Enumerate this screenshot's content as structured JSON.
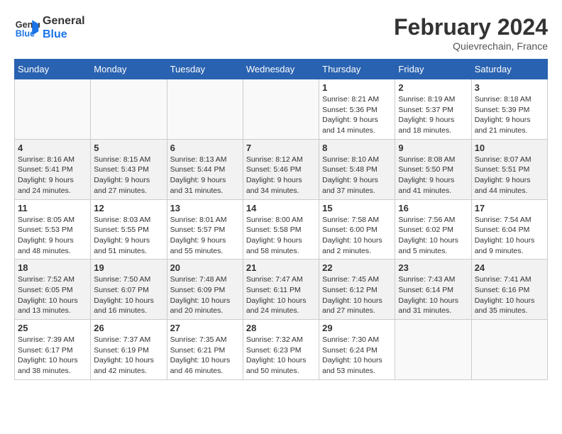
{
  "header": {
    "logo_line1": "General",
    "logo_line2": "Blue",
    "month_title": "February 2024",
    "location": "Quievrechain, France"
  },
  "days_of_week": [
    "Sunday",
    "Monday",
    "Tuesday",
    "Wednesday",
    "Thursday",
    "Friday",
    "Saturday"
  ],
  "weeks": [
    [
      {
        "day": "",
        "info": ""
      },
      {
        "day": "",
        "info": ""
      },
      {
        "day": "",
        "info": ""
      },
      {
        "day": "",
        "info": ""
      },
      {
        "day": "1",
        "info": "Sunrise: 8:21 AM\nSunset: 5:36 PM\nDaylight: 9 hours\nand 14 minutes."
      },
      {
        "day": "2",
        "info": "Sunrise: 8:19 AM\nSunset: 5:37 PM\nDaylight: 9 hours\nand 18 minutes."
      },
      {
        "day": "3",
        "info": "Sunrise: 8:18 AM\nSunset: 5:39 PM\nDaylight: 9 hours\nand 21 minutes."
      }
    ],
    [
      {
        "day": "4",
        "info": "Sunrise: 8:16 AM\nSunset: 5:41 PM\nDaylight: 9 hours\nand 24 minutes."
      },
      {
        "day": "5",
        "info": "Sunrise: 8:15 AM\nSunset: 5:43 PM\nDaylight: 9 hours\nand 27 minutes."
      },
      {
        "day": "6",
        "info": "Sunrise: 8:13 AM\nSunset: 5:44 PM\nDaylight: 9 hours\nand 31 minutes."
      },
      {
        "day": "7",
        "info": "Sunrise: 8:12 AM\nSunset: 5:46 PM\nDaylight: 9 hours\nand 34 minutes."
      },
      {
        "day": "8",
        "info": "Sunrise: 8:10 AM\nSunset: 5:48 PM\nDaylight: 9 hours\nand 37 minutes."
      },
      {
        "day": "9",
        "info": "Sunrise: 8:08 AM\nSunset: 5:50 PM\nDaylight: 9 hours\nand 41 minutes."
      },
      {
        "day": "10",
        "info": "Sunrise: 8:07 AM\nSunset: 5:51 PM\nDaylight: 9 hours\nand 44 minutes."
      }
    ],
    [
      {
        "day": "11",
        "info": "Sunrise: 8:05 AM\nSunset: 5:53 PM\nDaylight: 9 hours\nand 48 minutes."
      },
      {
        "day": "12",
        "info": "Sunrise: 8:03 AM\nSunset: 5:55 PM\nDaylight: 9 hours\nand 51 minutes."
      },
      {
        "day": "13",
        "info": "Sunrise: 8:01 AM\nSunset: 5:57 PM\nDaylight: 9 hours\nand 55 minutes."
      },
      {
        "day": "14",
        "info": "Sunrise: 8:00 AM\nSunset: 5:58 PM\nDaylight: 9 hours\nand 58 minutes."
      },
      {
        "day": "15",
        "info": "Sunrise: 7:58 AM\nSunset: 6:00 PM\nDaylight: 10 hours\nand 2 minutes."
      },
      {
        "day": "16",
        "info": "Sunrise: 7:56 AM\nSunset: 6:02 PM\nDaylight: 10 hours\nand 5 minutes."
      },
      {
        "day": "17",
        "info": "Sunrise: 7:54 AM\nSunset: 6:04 PM\nDaylight: 10 hours\nand 9 minutes."
      }
    ],
    [
      {
        "day": "18",
        "info": "Sunrise: 7:52 AM\nSunset: 6:05 PM\nDaylight: 10 hours\nand 13 minutes."
      },
      {
        "day": "19",
        "info": "Sunrise: 7:50 AM\nSunset: 6:07 PM\nDaylight: 10 hours\nand 16 minutes."
      },
      {
        "day": "20",
        "info": "Sunrise: 7:48 AM\nSunset: 6:09 PM\nDaylight: 10 hours\nand 20 minutes."
      },
      {
        "day": "21",
        "info": "Sunrise: 7:47 AM\nSunset: 6:11 PM\nDaylight: 10 hours\nand 24 minutes."
      },
      {
        "day": "22",
        "info": "Sunrise: 7:45 AM\nSunset: 6:12 PM\nDaylight: 10 hours\nand 27 minutes."
      },
      {
        "day": "23",
        "info": "Sunrise: 7:43 AM\nSunset: 6:14 PM\nDaylight: 10 hours\nand 31 minutes."
      },
      {
        "day": "24",
        "info": "Sunrise: 7:41 AM\nSunset: 6:16 PM\nDaylight: 10 hours\nand 35 minutes."
      }
    ],
    [
      {
        "day": "25",
        "info": "Sunrise: 7:39 AM\nSunset: 6:17 PM\nDaylight: 10 hours\nand 38 minutes."
      },
      {
        "day": "26",
        "info": "Sunrise: 7:37 AM\nSunset: 6:19 PM\nDaylight: 10 hours\nand 42 minutes."
      },
      {
        "day": "27",
        "info": "Sunrise: 7:35 AM\nSunset: 6:21 PM\nDaylight: 10 hours\nand 46 minutes."
      },
      {
        "day": "28",
        "info": "Sunrise: 7:32 AM\nSunset: 6:23 PM\nDaylight: 10 hours\nand 50 minutes."
      },
      {
        "day": "29",
        "info": "Sunrise: 7:30 AM\nSunset: 6:24 PM\nDaylight: 10 hours\nand 53 minutes."
      },
      {
        "day": "",
        "info": ""
      },
      {
        "day": "",
        "info": ""
      }
    ]
  ]
}
